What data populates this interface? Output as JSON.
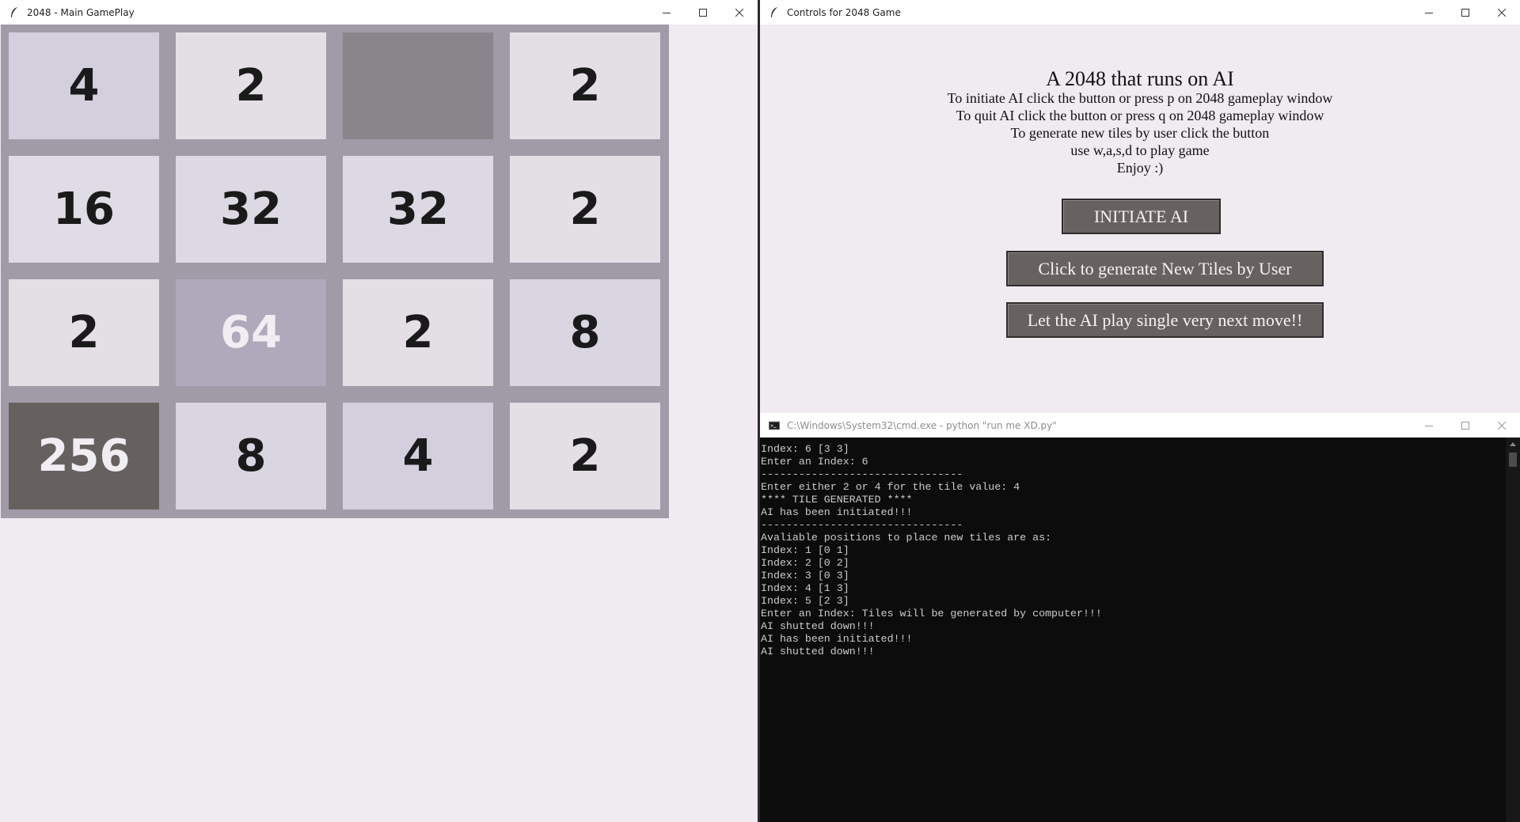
{
  "game_window": {
    "title": "2048 - Main GamePlay",
    "tiles": [
      {
        "value": "4",
        "bg": "#d3cfdd",
        "color": "#1a1a1a"
      },
      {
        "value": "2",
        "bg": "#e3dfe5",
        "color": "#1a1a1a"
      },
      {
        "value": "",
        "bg": "#8a858b",
        "color": "#1a1a1a"
      },
      {
        "value": "2",
        "bg": "#e3dfe5",
        "color": "#1a1a1a"
      },
      {
        "value": "16",
        "bg": "#e0dce5",
        "color": "#1a1a1a"
      },
      {
        "value": "32",
        "bg": "#ddd9e3",
        "color": "#1a1a1a"
      },
      {
        "value": "32",
        "bg": "#ddd9e3",
        "color": "#1a1a1a"
      },
      {
        "value": "2",
        "bg": "#e3dfe5",
        "color": "#1a1a1a"
      },
      {
        "value": "2",
        "bg": "#e3dfe5",
        "color": "#1a1a1a"
      },
      {
        "value": "64",
        "bg": "#aeaabb",
        "color": "#f1eef3"
      },
      {
        "value": "2",
        "bg": "#e3dfe5",
        "color": "#1a1a1a"
      },
      {
        "value": "8",
        "bg": "#d9d5e1",
        "color": "#1a1a1a"
      },
      {
        "value": "256",
        "bg": "#66615f",
        "color": "#f1eef3"
      },
      {
        "value": "8",
        "bg": "#d9d5e1",
        "color": "#1a1a1a"
      },
      {
        "value": "4",
        "bg": "#d3cfdd",
        "color": "#1a1a1a"
      },
      {
        "value": "2",
        "bg": "#e3dfe5",
        "color": "#1a1a1a"
      }
    ]
  },
  "controls_window": {
    "title": "Controls for 2048 Game",
    "heading": "A 2048 that runs on AI",
    "instructions": [
      "To initiate AI click the button or press p on 2048 gameplay window",
      "To quit AI click the button or press q on 2048 gameplay window",
      "To generate new tiles by user click the button",
      "use w,a,s,d to play game",
      "Enjoy :)"
    ],
    "buttons": {
      "initiate_ai": "INITIATE AI",
      "generate_tiles": "Click to generate New Tiles by User",
      "single_move": "Let the AI play single very next move!!"
    }
  },
  "console_window": {
    "title": "C:\\Windows\\System32\\cmd.exe - python  \"run me XD.py\"",
    "lines": [
      "Index: 6 [3 3]",
      "Enter an Index: 6",
      "--------------------------------",
      "Enter either 2 or 4 for the tile value: 4",
      "**** TILE GENERATED ****",
      "AI has been initiated!!!",
      "--------------------------------",
      "Avaliable positions to place new tiles are as:",
      "Index: 1 [0 1]",
      "Index: 2 [0 2]",
      "Index: 3 [0 3]",
      "Index: 4 [1 3]",
      "Index: 5 [2 3]",
      "Enter an Index: Tiles will be generated by computer!!!",
      "AI shutted down!!!",
      "AI has been initiated!!!",
      "AI shutted down!!!"
    ]
  },
  "icons": {
    "app": "feather-icon",
    "minimize": "minimize-icon",
    "maximize": "maximize-icon",
    "close": "close-icon",
    "console": "cmd-icon"
  }
}
